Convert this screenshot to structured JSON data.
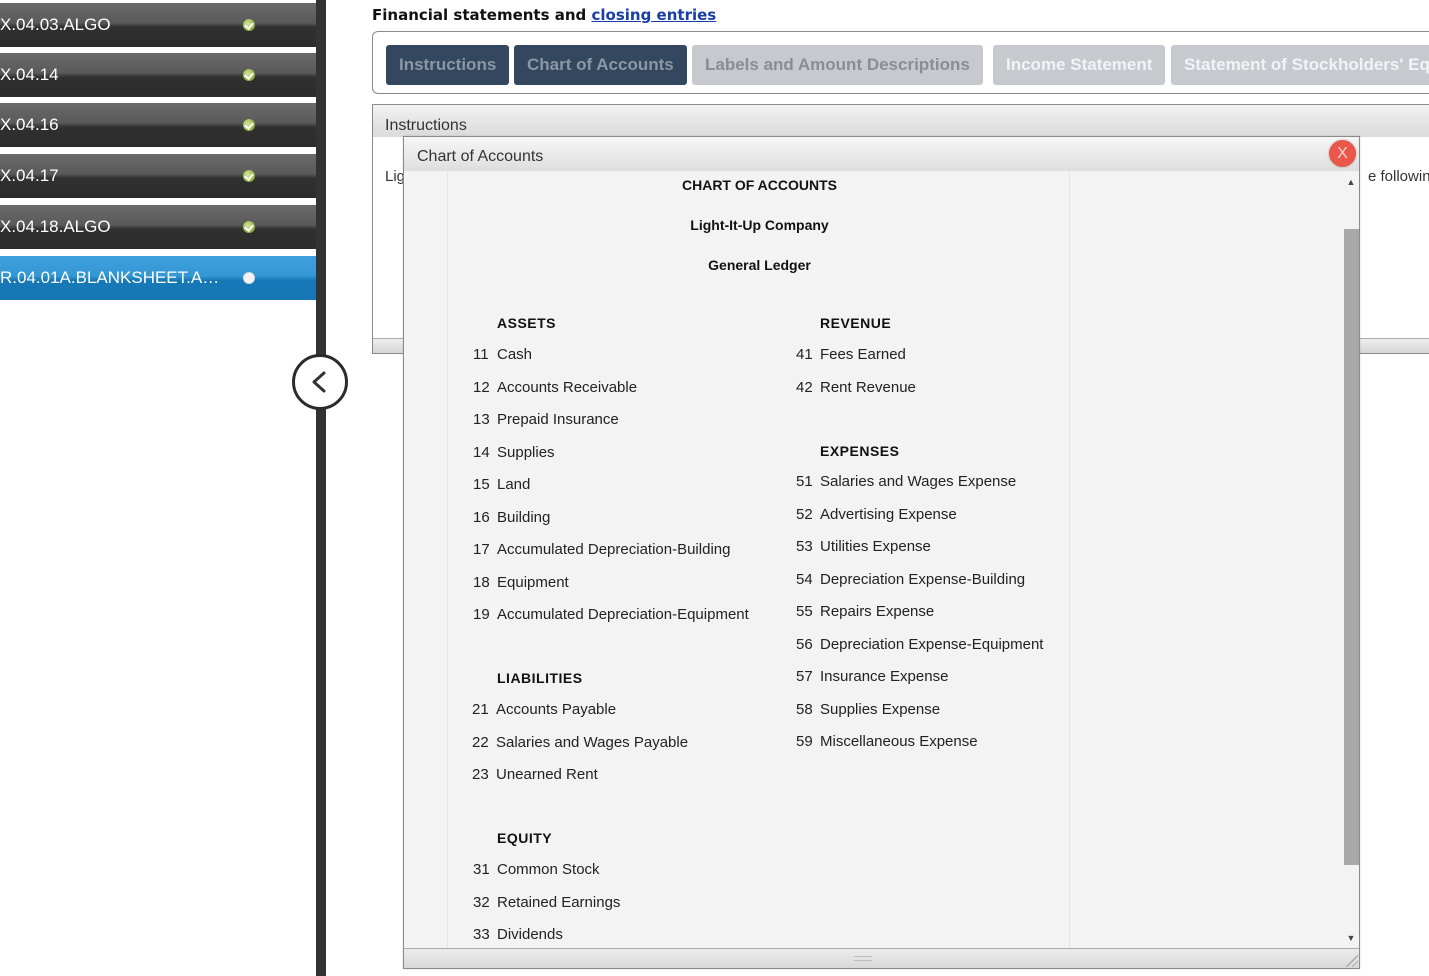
{
  "sidebar": {
    "items": [
      {
        "label": "X.04.03.ALGO",
        "status": "complete"
      },
      {
        "label": "X.04.14",
        "status": "complete"
      },
      {
        "label": "X.04.16",
        "status": "complete"
      },
      {
        "label": "X.04.17",
        "status": "complete"
      },
      {
        "label": "X.04.18.ALGO",
        "status": "complete"
      },
      {
        "label": "R.04.01A.BLANKSHEET.A…",
        "status": "current"
      }
    ],
    "collapse_icon": "chevron-left-icon"
  },
  "header": {
    "title_prefix": "Financial statements and ",
    "title_link": "closing entries"
  },
  "tabs": [
    {
      "label": "Instructions",
      "state": "dark"
    },
    {
      "label": "Chart of Accounts",
      "state": "dark"
    },
    {
      "label": "Labels and Amount Descriptions",
      "state": "light"
    },
    {
      "label": "Income Statement",
      "state": "light"
    },
    {
      "label": "Statement of Stockholders' Eq",
      "state": "light"
    }
  ],
  "instructions_panel": {
    "title": "Instructions",
    "body_left": "Lig",
    "body_right": "e following e"
  },
  "dialog": {
    "title": "Chart of Accounts",
    "close_label": "X",
    "heading": "CHART OF ACCOUNTS",
    "company": "Light-It-Up Company",
    "ledger": "General Ledger",
    "sections": {
      "assets": {
        "title": "ASSETS",
        "accounts": [
          {
            "num": "11",
            "name": "Cash"
          },
          {
            "num": "12",
            "name": "Accounts Receivable"
          },
          {
            "num": "13",
            "name": "Prepaid Insurance"
          },
          {
            "num": "14",
            "name": "Supplies"
          },
          {
            "num": "15",
            "name": "Land"
          },
          {
            "num": "16",
            "name": "Building"
          },
          {
            "num": "17",
            "name": "Accumulated Depreciation-Building"
          },
          {
            "num": "18",
            "name": "Equipment"
          },
          {
            "num": "19",
            "name": "Accumulated Depreciation-Equipment"
          }
        ]
      },
      "liabilities": {
        "title": "LIABILITIES",
        "accounts": [
          {
            "num": "21",
            "name": "Accounts Payable"
          },
          {
            "num": "22",
            "name": "Salaries and Wages Payable"
          },
          {
            "num": "23",
            "name": "Unearned Rent"
          }
        ]
      },
      "equity": {
        "title": "EQUITY",
        "accounts": [
          {
            "num": "31",
            "name": "Common Stock"
          },
          {
            "num": "32",
            "name": "Retained Earnings"
          },
          {
            "num": "33",
            "name": "Dividends"
          }
        ]
      },
      "revenue": {
        "title": "REVENUE",
        "accounts": [
          {
            "num": "41",
            "name": "Fees Earned"
          },
          {
            "num": "42",
            "name": "Rent Revenue"
          }
        ]
      },
      "expenses": {
        "title": "EXPENSES",
        "accounts": [
          {
            "num": "51",
            "name": "Salaries and Wages Expense"
          },
          {
            "num": "52",
            "name": "Advertising Expense"
          },
          {
            "num": "53",
            "name": "Utilities Expense"
          },
          {
            "num": "54",
            "name": "Depreciation Expense-Building"
          },
          {
            "num": "55",
            "name": "Repairs Expense"
          },
          {
            "num": "56",
            "name": "Depreciation Expense-Equipment"
          },
          {
            "num": "57",
            "name": "Insurance Expense"
          },
          {
            "num": "58",
            "name": "Supplies Expense"
          },
          {
            "num": "59",
            "name": "Miscellaneous Expense"
          }
        ]
      }
    }
  }
}
